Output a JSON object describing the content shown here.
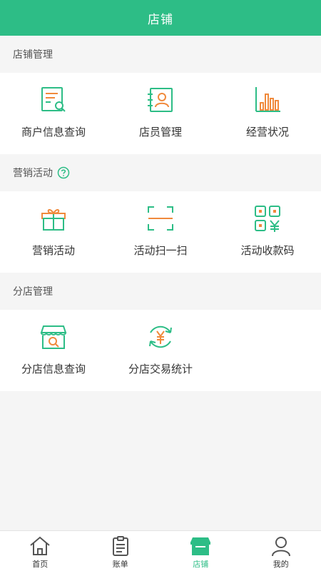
{
  "header": {
    "title": "店铺"
  },
  "sections": [
    {
      "title": "店铺管理",
      "items": [
        {
          "label": "商户信息查询",
          "icon": "merchant-info-search-icon"
        },
        {
          "label": "店员管理",
          "icon": "staff-id-card-icon"
        },
        {
          "label": "经营状况",
          "icon": "bar-chart-icon"
        }
      ]
    },
    {
      "title": "营销活动",
      "help_icon": "question-circle-icon",
      "items": [
        {
          "label": "营销活动",
          "icon": "gift-box-icon"
        },
        {
          "label": "活动扫一扫",
          "icon": "scan-frame-icon"
        },
        {
          "label": "活动收款码",
          "icon": "qr-payment-code-icon"
        }
      ]
    },
    {
      "title": "分店管理",
      "items": [
        {
          "label": "分店信息查询",
          "icon": "branch-store-search-icon"
        },
        {
          "label": "分店交易统计",
          "icon": "yuan-exchange-icon"
        }
      ]
    }
  ],
  "tabbar": {
    "items": [
      {
        "label": "首页",
        "icon": "home-icon"
      },
      {
        "label": "账单",
        "icon": "clipboard-icon"
      },
      {
        "label": "店铺",
        "icon": "store-icon",
        "active": true
      },
      {
        "label": "我的",
        "icon": "user-icon"
      }
    ]
  },
  "colors": {
    "brand": "#2dbd86",
    "accent": "#f08a3c",
    "background": "#f5f5f5"
  }
}
